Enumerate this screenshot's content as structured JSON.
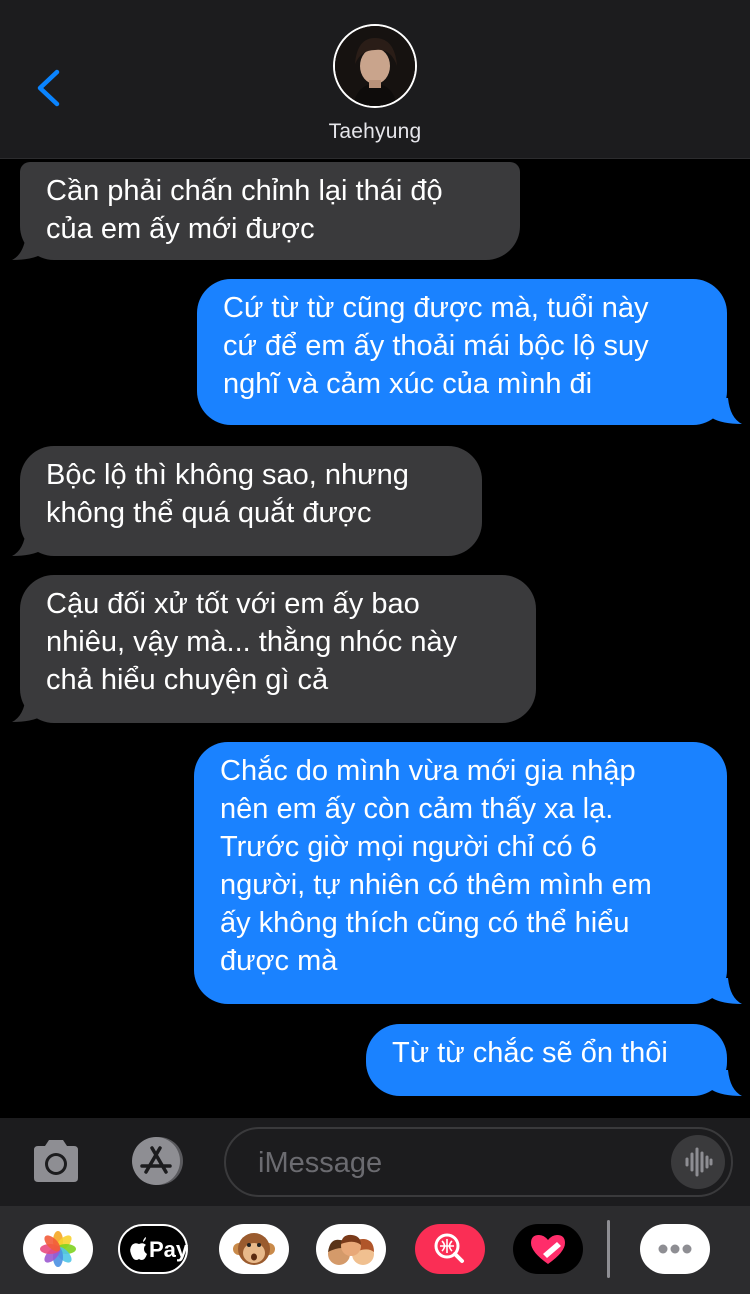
{
  "header": {
    "contact_name": "Taehyung"
  },
  "messages": [
    {
      "direction": "received",
      "text": "Cần phải chấn chỉnh lại thái độ\ncủa em ấy mới được"
    },
    {
      "direction": "sent",
      "text": "Cứ từ từ cũng được mà, tuổi này\ncứ để em ấy thoải mái bộc lộ suy\nnghĩ và cảm xúc của mình đi"
    },
    {
      "direction": "received",
      "text": "Bộc lộ thì không sao, nhưng\nkhông thể quá quắt được"
    },
    {
      "direction": "received",
      "text": "Cậu đối xử tốt với em ấy bao\nnhiêu, vậy mà... thằng nhóc này\nchả hiểu chuyện gì cả"
    },
    {
      "direction": "sent",
      "text": "Chắc do mình vừa mới gia nhập\nnên em ấy còn cảm thấy xa lạ.\nTrước giờ mọi người chỉ có 6\nngười, tự nhiên có thêm mình em\nấy không thích cũng có thể hiểu\nđược mà"
    },
    {
      "direction": "sent",
      "text": "Từ từ chắc sẽ ổn thôi"
    }
  ],
  "composer": {
    "placeholder": "iMessage"
  },
  "app_drawer": {
    "apps": [
      "photos-icon",
      "apple-pay-icon",
      "animoji-icon",
      "memoji-icon",
      "image-search-icon",
      "digital-touch-icon",
      "more-icon"
    ],
    "apple_pay_label": "Pay"
  },
  "colors": {
    "sent_bubble": "#1a82ff",
    "received_bubble": "#3a3a3c",
    "accent": "#0a84ff"
  }
}
